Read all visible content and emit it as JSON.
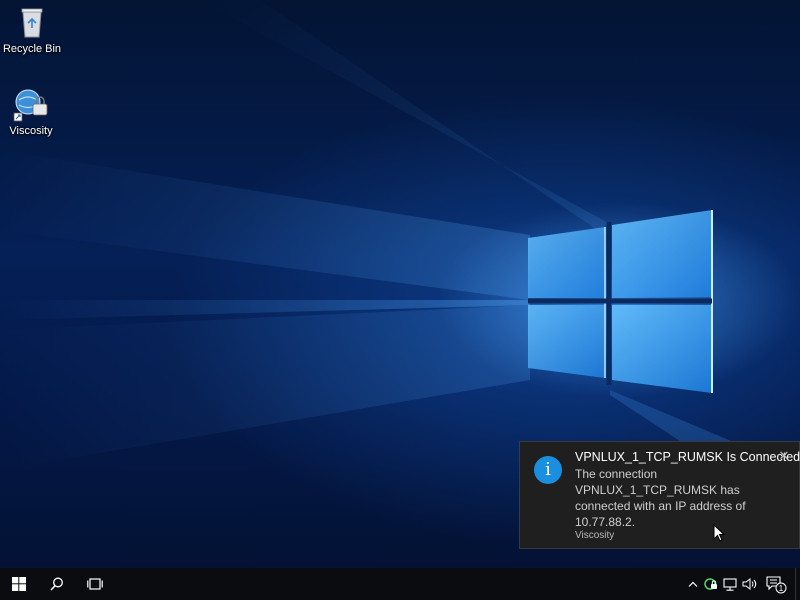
{
  "desktop": {
    "icons": [
      {
        "label": "Recycle Bin",
        "icon": "recycle-bin-icon"
      },
      {
        "label": "Viscosity",
        "icon": "viscosity-icon"
      }
    ]
  },
  "toast": {
    "title": "VPNLUX_1_TCP_RUMSK Is Connected",
    "body": "The connection VPNLUX_1_TCP_RUMSK has connected with an IP address of 10.77.88.2.",
    "app": "Viscosity",
    "icon_glyph": "i",
    "close_glyph": "✕",
    "accent": "#1a8fe0"
  },
  "taskbar": {
    "notification_count": "1",
    "items": [
      "start-icon",
      "search-icon",
      "task-view-icon"
    ],
    "tray": [
      "chevron-up-icon",
      "viscosity-tray-icon",
      "network-icon",
      "volume-icon",
      "action-center-icon"
    ]
  }
}
